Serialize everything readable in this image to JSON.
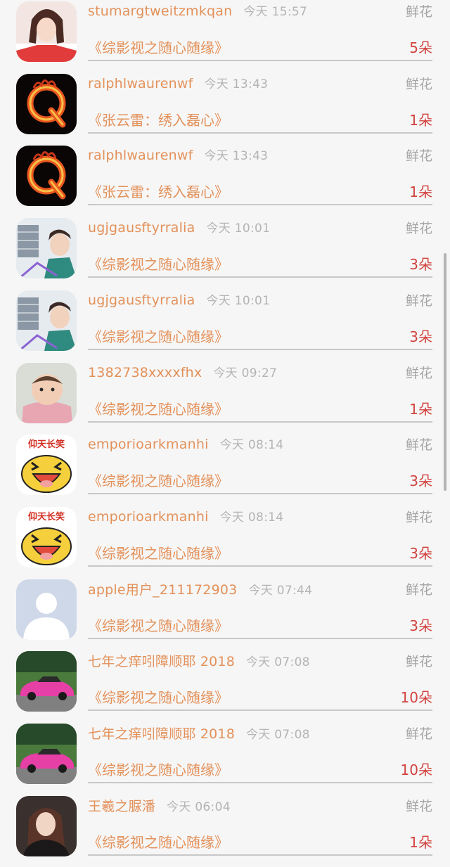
{
  "gift_list": [
    {
      "username": "stumargtweitzmkqan",
      "time": "今天 15:57",
      "gift_type": "鲜花",
      "book_title": "《综影视之随心随缘》",
      "count": "5朵",
      "avatar": "girl-photo"
    },
    {
      "username": "ralphlwaurenwf",
      "time": "今天 13:43",
      "gift_type": "鲜花",
      "book_title": "《张云雷：绣入磊心》",
      "count": "1朵",
      "avatar": "fire-q-logo"
    },
    {
      "username": "ralphlwaurenwf",
      "time": "今天 13:43",
      "gift_type": "鲜花",
      "book_title": "《张云雷：绣入磊心》",
      "count": "1朵",
      "avatar": "fire-q-logo"
    },
    {
      "username": "ugjgausftyrralia",
      "time": "今天 10:01",
      "gift_type": "鲜花",
      "book_title": "《综影视之随心随缘》",
      "count": "3朵",
      "avatar": "boy-photo"
    },
    {
      "username": "ugjgausftyrralia",
      "time": "今天 10:01",
      "gift_type": "鲜花",
      "book_title": "《综影视之随心随缘》",
      "count": "3朵",
      "avatar": "boy-photo"
    },
    {
      "username": "1382738xxxxfhx",
      "time": "今天 09:27",
      "gift_type": "鲜花",
      "book_title": "《综影视之随心随缘》",
      "count": "1朵",
      "avatar": "baby-photo"
    },
    {
      "username": "emporioarkmanhi",
      "time": "今天 08:14",
      "gift_type": "鲜花",
      "book_title": "《综影视之随心随缘》",
      "count": "3朵",
      "avatar": "laughing-cartoon",
      "avatar_text": "仰天长笑"
    },
    {
      "username": "emporioarkmanhi",
      "time": "今天 08:14",
      "gift_type": "鲜花",
      "book_title": "《综影视之随心随缘》",
      "count": "3朵",
      "avatar": "laughing-cartoon",
      "avatar_text": "仰天长笑"
    },
    {
      "username": "apple用户_211172903",
      "time": "今天 07:44",
      "gift_type": "鲜花",
      "book_title": "《综影视之随心随缘》",
      "count": "3朵",
      "avatar": "default-user"
    },
    {
      "username": "七年之痒吲障顺耶 2018",
      "time": "今天 07:08",
      "gift_type": "鲜花",
      "book_title": "《综影视之随心随缘》",
      "count": "10朵",
      "avatar": "pink-car"
    },
    {
      "username": "七年之痒吲障顺耶 2018",
      "time": "今天 07:08",
      "gift_type": "鲜花",
      "book_title": "《综影视之随心随缘》",
      "count": "10朵",
      "avatar": "pink-car"
    },
    {
      "username": "王羲之脲潘",
      "time": "今天 06:04",
      "gift_type": "鲜花",
      "book_title": "《综影视之随心随缘》",
      "count": "1朵",
      "avatar": "woman-photo"
    }
  ],
  "colors": {
    "username": "#e3915a",
    "time": "#b4b4b4",
    "gift_type": "#a5a5a5",
    "count": "#d2423e",
    "background": "#f6f6f6"
  }
}
